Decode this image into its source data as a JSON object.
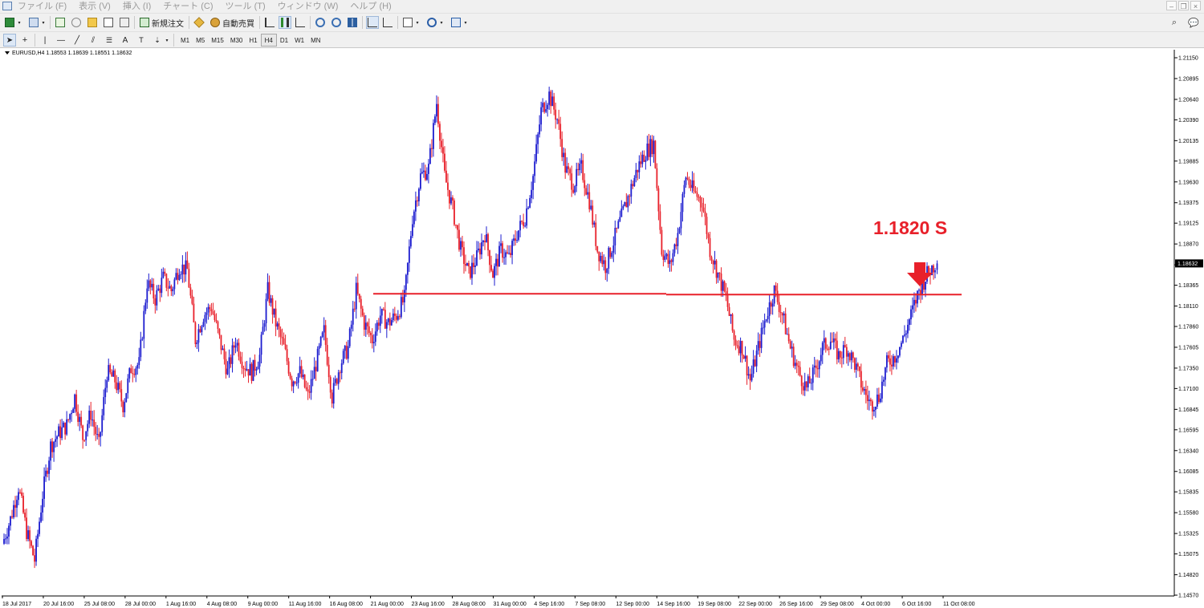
{
  "menu": {
    "items": [
      "ファイル (F)",
      "表示 (V)",
      "挿入 (I)",
      "チャート (C)",
      "ツール (T)",
      "ウィンドウ (W)",
      "ヘルプ (H)"
    ]
  },
  "toolbar": {
    "new_order_label": "新規注文",
    "auto_trade_label": "自動売買",
    "timeframes": [
      "M1",
      "M5",
      "M15",
      "M30",
      "H1",
      "H4",
      "D1",
      "W1",
      "MN"
    ],
    "active_timeframe": "H4",
    "draw_text_tool": "A"
  },
  "symbol_info": "EURUSD,H4  1.18553 1.18639 1.18551 1.18632",
  "colors": {
    "bull": "#1c1ccf",
    "bear": "#e8202a",
    "annotation": "#e8202a",
    "window_bg": "#f0f0f0"
  },
  "chart_data": {
    "type": "candlestick",
    "symbol": "EURUSD",
    "timeframe": "H4",
    "ohlc": {
      "open": 1.18553,
      "high": 1.18639,
      "low": 1.18551,
      "close": 1.18632
    },
    "current_price_label": "1.18632",
    "ylim": [
      1.1445,
      1.2165
    ],
    "y_ticks": [
      "1.21150",
      "1.20895",
      "1.20640",
      "1.20390",
      "1.20135",
      "1.19885",
      "1.19630",
      "1.19375",
      "1.19125",
      "1.18870",
      "1.18615",
      "1.18365",
      "1.18110",
      "1.17860",
      "1.17605",
      "1.17350",
      "1.17100",
      "1.16845",
      "1.16595",
      "1.16340",
      "1.16085",
      "1.15835",
      "1.15580",
      "1.15325",
      "1.15075",
      "1.14820",
      "1.14570"
    ],
    "x_ticks": [
      "18 Jul 2017",
      "20 Jul 16:00",
      "25 Jul 08:00",
      "28 Jul 00:00",
      "1 Aug 16:00",
      "4 Aug 08:00",
      "9 Aug 00:00",
      "11 Aug 16:00",
      "16 Aug 08:00",
      "21 Aug 00:00",
      "23 Aug 16:00",
      "28 Aug 08:00",
      "31 Aug 00:00",
      "4 Sep 16:00",
      "7 Sep 08:00",
      "12 Sep 00:00",
      "14 Sep 16:00",
      "19 Sep 08:00",
      "22 Sep 00:00",
      "26 Sep 16:00",
      "29 Sep 08:00",
      "4 Oct 00:00",
      "6 Oct 16:00",
      "11 Oct 08:00"
    ],
    "close_path": [
      [
        0,
        1.152
      ],
      [
        1,
        1.155
      ],
      [
        2,
        1.159
      ],
      [
        3,
        1.1535
      ],
      [
        4,
        1.15
      ],
      [
        5,
        1.158
      ],
      [
        6,
        1.164
      ],
      [
        7,
        1.1655
      ],
      [
        8,
        1.1665
      ],
      [
        9,
        1.17
      ],
      [
        10,
        1.165
      ],
      [
        11,
        1.168
      ],
      [
        12,
        1.164
      ],
      [
        13,
        1.173
      ],
      [
        14,
        1.172
      ],
      [
        15,
        1.169
      ],
      [
        16,
        1.1735
      ],
      [
        17,
        1.174
      ],
      [
        18,
        1.184
      ],
      [
        19,
        1.182
      ],
      [
        20,
        1.1845
      ],
      [
        21,
        1.183
      ],
      [
        22,
        1.186
      ],
      [
        23,
        1.1855
      ],
      [
        24,
        1.177
      ],
      [
        25,
        1.18
      ],
      [
        26,
        1.181
      ],
      [
        27,
        1.177
      ],
      [
        28,
        1.173
      ],
      [
        29,
        1.177
      ],
      [
        30,
        1.174
      ],
      [
        31,
        1.173
      ],
      [
        32,
        1.175
      ],
      [
        33,
        1.183
      ],
      [
        34,
        1.179
      ],
      [
        35,
        1.176
      ],
      [
        36,
        1.172
      ],
      [
        37,
        1.173
      ],
      [
        38,
        1.17
      ],
      [
        39,
        1.174
      ],
      [
        40,
        1.178
      ],
      [
        41,
        1.17
      ],
      [
        42,
        1.174
      ],
      [
        43,
        1.176
      ],
      [
        44,
        1.183
      ],
      [
        45,
        1.179
      ],
      [
        46,
        1.177
      ],
      [
        47,
        1.18
      ],
      [
        48,
        1.179
      ],
      [
        49,
        1.18
      ],
      [
        50,
        1.182
      ],
      [
        51,
        1.192
      ],
      [
        52,
        1.197
      ],
      [
        53,
        1.198
      ],
      [
        54,
        1.206
      ],
      [
        55,
        1.197
      ],
      [
        56,
        1.193
      ],
      [
        57,
        1.188
      ],
      [
        58,
        1.185
      ],
      [
        59,
        1.187
      ],
      [
        60,
        1.19
      ],
      [
        61,
        1.185
      ],
      [
        62,
        1.188
      ],
      [
        63,
        1.187
      ],
      [
        64,
        1.19
      ],
      [
        65,
        1.192
      ],
      [
        66,
        1.197
      ],
      [
        67,
        1.205
      ],
      [
        68,
        1.207
      ],
      [
        69,
        1.204
      ],
      [
        70,
        1.198
      ],
      [
        71,
        1.196
      ],
      [
        72,
        1.198
      ],
      [
        73,
        1.194
      ],
      [
        74,
        1.188
      ],
      [
        75,
        1.186
      ],
      [
        76,
        1.189
      ],
      [
        77,
        1.192
      ],
      [
        78,
        1.195
      ],
      [
        79,
        1.198
      ],
      [
        80,
        1.2
      ],
      [
        81,
        1.201
      ],
      [
        82,
        1.188
      ],
      [
        83,
        1.186
      ],
      [
        84,
        1.19
      ],
      [
        85,
        1.197
      ],
      [
        86,
        1.195
      ],
      [
        87,
        1.194
      ],
      [
        88,
        1.188
      ],
      [
        89,
        1.185
      ],
      [
        90,
        1.182
      ],
      [
        91,
        1.177
      ],
      [
        92,
        1.176
      ],
      [
        93,
        1.172
      ],
      [
        94,
        1.176
      ],
      [
        95,
        1.18
      ],
      [
        96,
        1.183
      ],
      [
        97,
        1.18
      ],
      [
        98,
        1.176
      ],
      [
        99,
        1.173
      ],
      [
        100,
        1.171
      ],
      [
        101,
        1.173
      ],
      [
        102,
        1.176
      ],
      [
        103,
        1.177
      ],
      [
        104,
        1.175
      ],
      [
        105,
        1.176
      ],
      [
        106,
        1.174
      ],
      [
        107,
        1.171
      ],
      [
        108,
        1.169
      ],
      [
        109,
        1.17
      ],
      [
        110,
        1.174
      ],
      [
        111,
        1.175
      ],
      [
        112,
        1.177
      ],
      [
        113,
        1.18
      ],
      [
        114,
        1.183
      ],
      [
        115,
        1.185
      ],
      [
        116,
        1.1863
      ]
    ],
    "annotations": {
      "horizontal_line_price": 1.1825,
      "label": "1.1820 S",
      "arrow_direction": "down"
    }
  }
}
